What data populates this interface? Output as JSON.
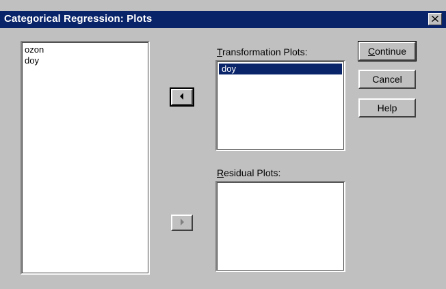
{
  "window": {
    "title": "Categorical Regression: Plots",
    "close_icon": "close-icon"
  },
  "source_list": {
    "items": [
      "ozon",
      "doy"
    ]
  },
  "transformation_plots": {
    "label_accel": "T",
    "label_rest": "ransformation Plots:",
    "items": [
      "doy"
    ],
    "selected_index": 0
  },
  "residual_plots": {
    "label_accel": "R",
    "label_rest": "esidual Plots:",
    "items": []
  },
  "buttons": {
    "continue_accel": "C",
    "continue_rest": "ontinue",
    "cancel": "Cancel",
    "help": "Help"
  },
  "arrows": {
    "move_left_icon": "arrow-left-icon",
    "move_right_icon": "arrow-right-icon"
  },
  "colors": {
    "titlebar": "#0a246a",
    "selection": "#0a246a",
    "face": "#c0c0c0"
  }
}
